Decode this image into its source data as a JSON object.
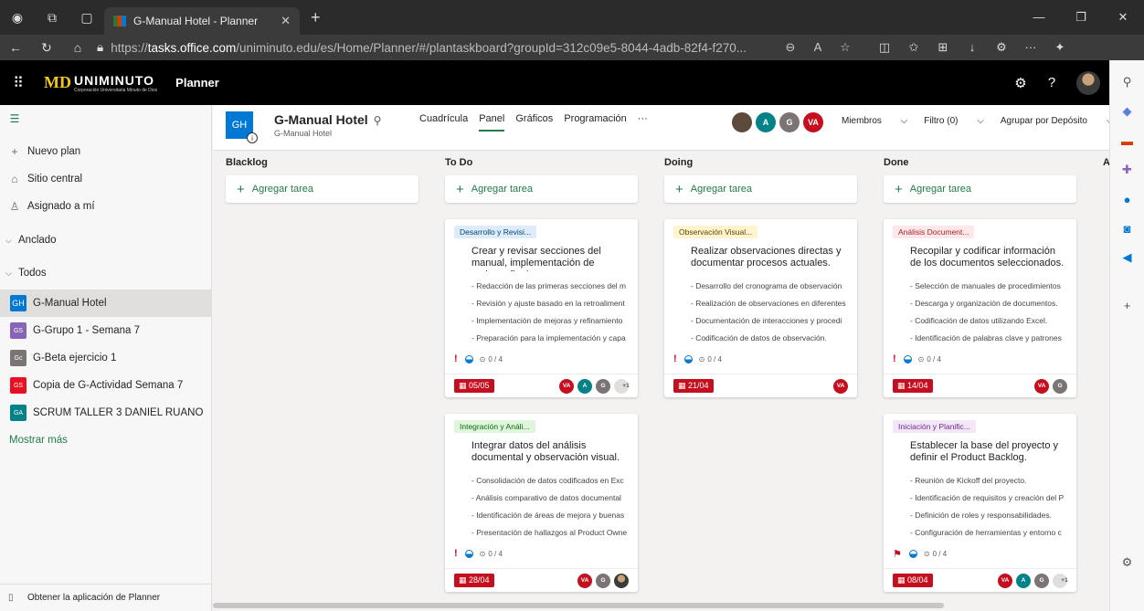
{
  "browser": {
    "tab_title": "G-Manual Hotel - Planner",
    "url_prefix": "https://",
    "url_host": "tasks.office.com",
    "url_rest": "/uniminuto.edu/es/Home/Planner/#/plantaskboard?groupId=312c09e5-8044-4adb-82f4-f270..."
  },
  "suite": {
    "logo_text": "UNIMINUTO",
    "logo_sub": "Corporación Universitaria Minuto de Dios",
    "app_name": "Planner"
  },
  "leftnav": {
    "new_plan": "Nuevo plan",
    "hub": "Sitio central",
    "assigned": "Asignado a mí",
    "pinned": "Anclado",
    "all": "Todos",
    "plans": [
      {
        "badge": "GH",
        "name": "G-Manual Hotel",
        "color": "#0078d4"
      },
      {
        "badge": "GS",
        "name": "G-Grupo 1 - Semana 7",
        "color": "#8764b8"
      },
      {
        "badge": "Gc",
        "name": "G-Beta ejercicio 1",
        "color": "#7a7574"
      },
      {
        "badge": "GS",
        "name": "Copia de G-Actividad Semana 7",
        "color": "#e81123"
      },
      {
        "badge": "GA",
        "name": "SCRUM TALLER 3 DANIEL RUANO",
        "color": "#038387"
      }
    ],
    "show_more": "Mostrar más",
    "get_app": "Obtener la aplicación de Planner"
  },
  "plan": {
    "badge": "GH",
    "title": "G-Manual Hotel",
    "subtitle": "G-Manual Hotel",
    "views": [
      "Cuadrícula",
      "Panel",
      "Gráficos",
      "Programación",
      "···"
    ],
    "members_label": "Miembros",
    "filter_label": "Filtro (0)",
    "group_label": "Agrupar por Depósito",
    "members": [
      {
        "initials": "",
        "color": "#5c4a3d"
      },
      {
        "initials": "A",
        "color": "#038387"
      },
      {
        "initials": "G",
        "color": "#7a7574"
      },
      {
        "initials": "VA",
        "color": "#c50f1f"
      }
    ]
  },
  "columns": {
    "backlog": {
      "title": "Blacklog",
      "add": "Agregar tarea"
    },
    "todo": {
      "title": "To Do",
      "add": "Agregar tarea"
    },
    "doing": {
      "title": "Doing",
      "add": "Agregar tarea"
    },
    "done": {
      "title": "Done",
      "add": "Agregar tarea"
    },
    "next_partial": "A"
  },
  "cards": {
    "todo1": {
      "label": "Desarrollo y Revisi...",
      "title": "Crear y revisar secciones del manual, implementación de mejoras finales.",
      "items": [
        "- Redacción de las primeras secciones del m",
        "- Revisión y ajuste basado en la retroaliment",
        "- Implementación de mejoras y refinamiento",
        "- Preparación para la implementación y capa"
      ],
      "progress": "0 / 4",
      "date": "05/05"
    },
    "todo2": {
      "label": "Integración y Análi...",
      "title": "Integrar datos del análisis documental y observación visual.",
      "items": [
        "- Consolidación de datos codificados en Exc",
        "- Análisis comparativo de datos documental",
        "- Identificación de áreas de mejora y buenas",
        "- Presentación de hallazgos al Product Owne"
      ],
      "progress": "0 / 4",
      "date": "28/04"
    },
    "doing1": {
      "label": "Observación Visual...",
      "title": "Realizar observaciones directas y documentar procesos actuales.",
      "items": [
        "- Desarrollo del cronograma de observación",
        "- Realización de observaciones en diferentes",
        "- Documentación de interacciones y procedi",
        "- Codificación de datos de observación."
      ],
      "progress": "0 / 4",
      "date": "21/04"
    },
    "done1": {
      "label": "Análisis Document...",
      "title": "Recopilar y codificar información de los documentos seleccionados.",
      "items": [
        "- Selección de manuales de procedimientos",
        "- Descarga y organización de documentos.",
        "- Codificación de datos utilizando Excel.",
        "- Identificación de palabras clave y patrones"
      ],
      "progress": "0 / 4",
      "date": "14/04"
    },
    "done2": {
      "label": "Iniciación y Planific...",
      "title": "Establecer la base del proyecto y definir el Product Backlog.",
      "items": [
        "- Reunión de Kickoff del proyecto.",
        "- Identificación de requisitos y creación del P",
        "- Definición de roles y responsabilidades.",
        "- Configuración de herramientas y entorno c"
      ],
      "progress": "0 / 4",
      "date": "08/04"
    },
    "more_count": "+1",
    "av_va": "VA",
    "av_a": "A",
    "av_g": "G"
  }
}
